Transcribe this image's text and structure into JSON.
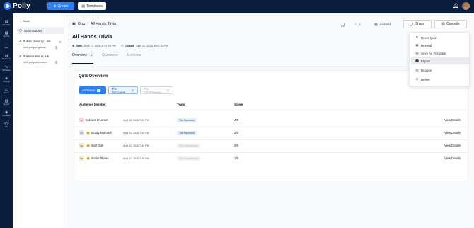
{
  "brand": {
    "name": "Polly"
  },
  "topbar": {
    "create_label": "Create",
    "templates_label": "Templates"
  },
  "rail": [
    {
      "icon": "home-icon",
      "glyph": "▤",
      "label": "My Pollys"
    },
    {
      "icon": "quizzes-icon",
      "glyph": "▦",
      "label": "Quizzes"
    },
    {
      "icon": "qna-icon",
      "glyph": "◌",
      "label": "Q&A"
    },
    {
      "icon": "my-events-icon",
      "glyph": "◍",
      "label": "My Events"
    },
    {
      "icon": "workflows-icon",
      "glyph": "⌥",
      "label": "Workflows"
    },
    {
      "icon": "pulsings-icon",
      "glyph": "◈",
      "label": "Pulsings"
    },
    {
      "icon": "folders-icon",
      "glyph": "▭",
      "label": "Folders"
    },
    {
      "icon": "reports-icon",
      "glyph": "▥",
      "label": "Reports"
    },
    {
      "icon": "templates-icon",
      "glyph": "◉",
      "label": "Templates"
    },
    {
      "icon": "api-icon",
      "glyph": "</>",
      "label": "API"
    }
  ],
  "sidepanel": {
    "back_label": "Back",
    "submissions_label": "Submissions",
    "public_link_title": "Public Joining Link",
    "public_link_url": "web.polly.ai/gtkhak",
    "presentation_title": "Presentation Link",
    "presentation_url": "web.polly.ai/presen..."
  },
  "header": {
    "breadcrumb_root": "Quiz",
    "breadcrumb_current": "All Hands Trivia",
    "title": "All Hands Trivia",
    "sent_label": "Sent:",
    "sent_value": "April 12, 2026 at 07:26 PM",
    "closed_label": "Closed:",
    "closed_value": "April 12, 2026 at 07:32 PM",
    "responders_count": "3",
    "status": "Closed",
    "share_label": "Share",
    "controls_label": "Controls"
  },
  "tabs": [
    {
      "label": "Overview",
      "badge": "4",
      "active": true
    },
    {
      "label": "Questions",
      "badge": "",
      "active": false
    },
    {
      "label": "Audience",
      "badge": "",
      "active": false
    }
  ],
  "overview": {
    "title": "Quiz Overview",
    "filters": [
      {
        "label": "All Teams",
        "count": "4"
      },
      {
        "label": "The Raccoons",
        "count": "2"
      },
      {
        "label": "The Condolences",
        "count": "2"
      }
    ],
    "columns": {
      "member": "Audience Member",
      "team": "Team",
      "score": "Score"
    },
    "rows": [
      {
        "initials": "R",
        "avatar_color": "#f7d6e0",
        "name": "rakham khurram",
        "date": "April 12, 2026 7:26 PM",
        "team": "The Raccoons",
        "team_type": "rac",
        "score": "4/5",
        "action": "View Details"
      },
      {
        "initials": "SN",
        "avatar_color": "#e2e5ea",
        "name": "🐱 Sturdy Nuthatch",
        "date": "April 12, 2026 7:28 PM",
        "team": "The Raccoons",
        "team_type": "rac",
        "score": "2/5",
        "action": "View Details"
      },
      {
        "initials": "SG",
        "avatar_color": "#f3e7c9",
        "name": "🐱 Swift Gull",
        "date": "April 12, 2026 7:28 PM",
        "team": "The Condolences",
        "team_type": "con",
        "score": "2/5",
        "action": "View Details"
      },
      {
        "initials": "SP",
        "avatar_color": "#f3e7c9",
        "name": "🐱 Stellar Plover",
        "date": "April 12, 2026 7:28 PM",
        "team": "The Condolences",
        "team_type": "con",
        "score": "1/5",
        "action": "View Details"
      }
    ]
  },
  "dropdown": {
    "items": [
      {
        "icon": "reset-icon",
        "glyph": "↻",
        "label": "Reset Quiz"
      },
      {
        "icon": "resend-icon",
        "glyph": "▣",
        "label": "Resend"
      },
      {
        "icon": "save-template-icon",
        "glyph": "▤",
        "label": "Save As Template"
      },
      {
        "icon": "export-icon",
        "glyph": "⬤",
        "label": "Export",
        "hover": true
      },
      {
        "icon": "reopen-icon",
        "glyph": "▥",
        "label": "Reopen"
      },
      {
        "icon": "delete-icon",
        "glyph": "⊘",
        "label": "Delete"
      }
    ]
  }
}
